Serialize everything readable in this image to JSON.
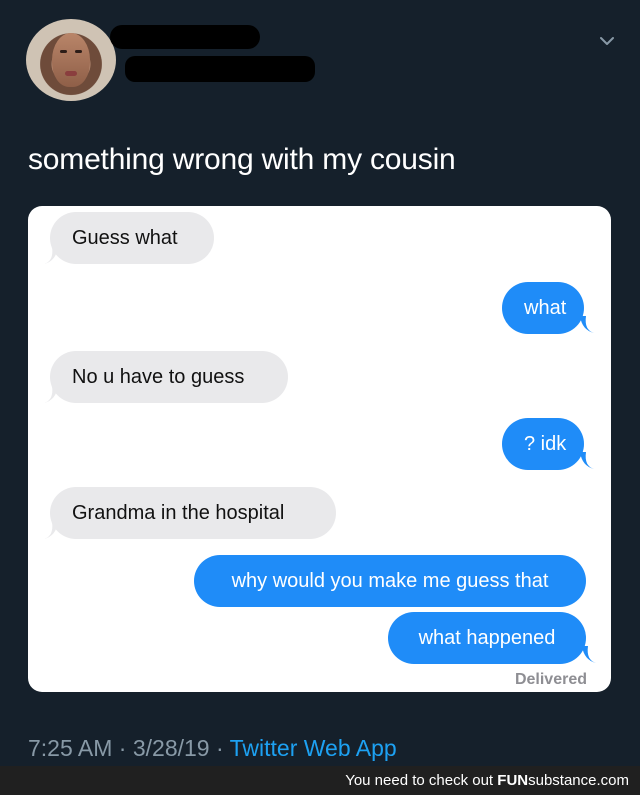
{
  "tweet": {
    "text": "something wrong with my cousin",
    "time": "7:25 AM",
    "separator": "·",
    "date": "3/28/19",
    "source": "Twitter Web App"
  },
  "messages": [
    {
      "text": "Guess what",
      "direction": "incoming"
    },
    {
      "text": "what",
      "direction": "outgoing"
    },
    {
      "text": "No u have to guess",
      "direction": "incoming"
    },
    {
      "text": "? idk",
      "direction": "outgoing"
    },
    {
      "text": "Grandma in the hospital",
      "direction": "incoming"
    },
    {
      "text": "why would you make me guess that",
      "direction": "outgoing"
    },
    {
      "text": "what happened",
      "direction": "outgoing"
    }
  ],
  "delivered_label": "Delivered",
  "footer": {
    "text": "You need to check out",
    "brand_bold": "FUN",
    "brand_rest": "substance.com"
  },
  "colors": {
    "background": "#15202b",
    "incoming_bubble": "#e9e9eb",
    "outgoing_bubble": "#1f8cf8",
    "source_link": "#1da1f2",
    "meta_text": "#8899a6"
  },
  "icons": {
    "menu": "chevron-down-icon"
  }
}
